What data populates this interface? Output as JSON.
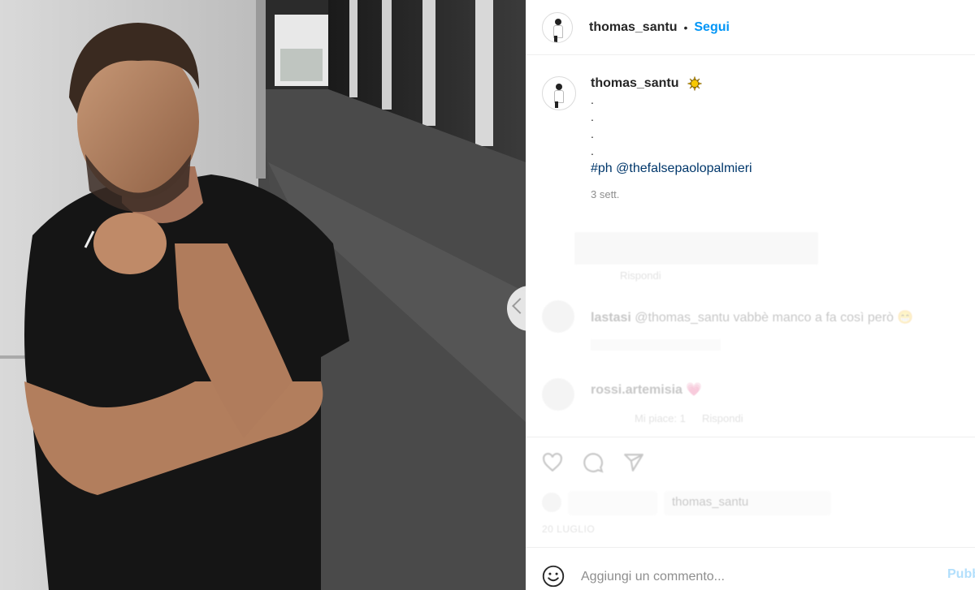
{
  "post": {
    "username": "thomas_santu",
    "separator": "•",
    "follow_label": "Segui",
    "caption": {
      "username": "thomas_santu",
      "emoji": "sun-icon",
      "dots": [
        ".",
        ".",
        ".",
        "."
      ],
      "hashtag": "#ph",
      "mention": "@thefalsepaolopalmieri",
      "time": "3 sett."
    }
  },
  "comments": [
    {
      "reply_label": "Rispondi"
    },
    {
      "username": "lastasi",
      "text": "@thomas_santu vabbè manco a fa così però 😁"
    },
    {
      "username": "rossi.artemisia",
      "text": "💗",
      "likes_label": "Mi piace: 1",
      "reply_label": "Rispondi"
    }
  ],
  "actions": {
    "likes_text": "thomas_santu",
    "date": "20 LUGLIO"
  },
  "composer": {
    "placeholder": "Aggiungi un commento...",
    "publish_label": "Pubblica"
  },
  "colors": {
    "link_blue": "#0095f6",
    "hashtag_blue": "#00376b",
    "muted_gray": "#8e8e8e",
    "divider": "#efefef"
  }
}
